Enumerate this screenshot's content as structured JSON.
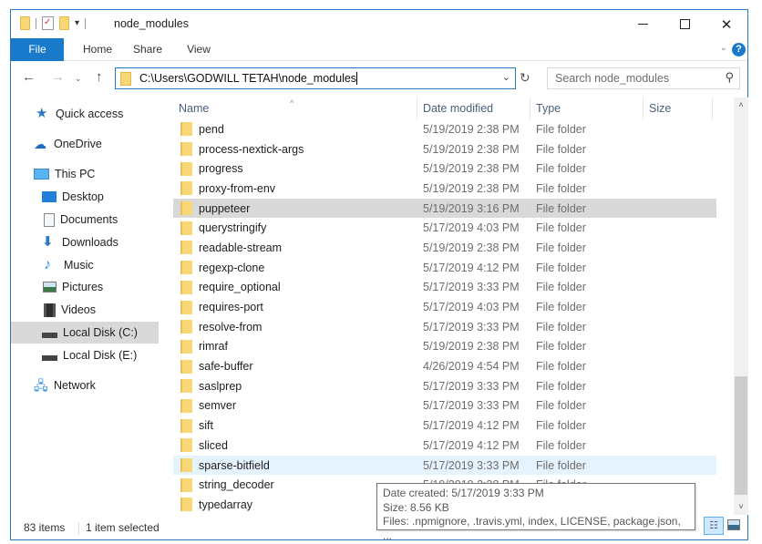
{
  "window": {
    "title": "node_modules",
    "controls": {
      "minimize": "–",
      "maximize": "□",
      "close": "✕"
    }
  },
  "quick_access_toolbar": {
    "icons": [
      "folder-icon",
      "properties-icon",
      "new-folder-icon"
    ],
    "dropdown": "▾"
  },
  "ribbon": {
    "tabs": [
      {
        "label": "File",
        "active": true
      },
      {
        "label": "Home"
      },
      {
        "label": "Share"
      },
      {
        "label": "View"
      }
    ],
    "expand_chevron": "⌄",
    "help": "?"
  },
  "navigation": {
    "back": "←",
    "forward": "→",
    "recent": "⌄",
    "up": "↑",
    "address": "C:\\Users\\GODWILL TETAH\\node_modules",
    "address_dropdown": "⌄",
    "refresh": "↻",
    "search_placeholder": "Search node_modules",
    "search_icon": "⚲"
  },
  "nav_pane": {
    "items": [
      {
        "label": "Quick access",
        "icon": "star-icon",
        "level": 0
      },
      {
        "label": "OneDrive",
        "icon": "cloud-icon",
        "level": 0
      },
      {
        "label": "This PC",
        "icon": "computer-icon",
        "level": 0
      },
      {
        "label": "Desktop",
        "icon": "desktop-icon",
        "level": 1
      },
      {
        "label": "Documents",
        "icon": "documents-icon",
        "level": 1
      },
      {
        "label": "Downloads",
        "icon": "download-icon",
        "level": 1
      },
      {
        "label": "Music",
        "icon": "music-icon",
        "level": 1
      },
      {
        "label": "Pictures",
        "icon": "pictures-icon",
        "level": 1
      },
      {
        "label": "Videos",
        "icon": "videos-icon",
        "level": 1
      },
      {
        "label": "Local Disk (C:)",
        "icon": "drive-icon",
        "level": 1,
        "selected": true
      },
      {
        "label": "Local Disk  (E:)",
        "icon": "drive-icon",
        "level": 1
      },
      {
        "label": "Network",
        "icon": "network-icon",
        "level": 0
      }
    ]
  },
  "file_list": {
    "columns": [
      "Name",
      "Date modified",
      "Type",
      "Size"
    ],
    "sort_indicator": "^",
    "rows": [
      {
        "name": "pend",
        "date": "5/19/2019 2:38 PM",
        "type": "File folder",
        "size": ""
      },
      {
        "name": "process-nextick-args",
        "date": "5/19/2019 2:38 PM",
        "type": "File folder",
        "size": ""
      },
      {
        "name": "progress",
        "date": "5/19/2019 2:38 PM",
        "type": "File folder",
        "size": ""
      },
      {
        "name": "proxy-from-env",
        "date": "5/19/2019 2:38 PM",
        "type": "File folder",
        "size": ""
      },
      {
        "name": "puppeteer",
        "date": "5/19/2019 3:16 PM",
        "type": "File folder",
        "size": "",
        "state": "selected"
      },
      {
        "name": "querystringify",
        "date": "5/17/2019 4:03 PM",
        "type": "File folder",
        "size": ""
      },
      {
        "name": "readable-stream",
        "date": "5/19/2019 2:38 PM",
        "type": "File folder",
        "size": ""
      },
      {
        "name": "regexp-clone",
        "date": "5/17/2019 4:12 PM",
        "type": "File folder",
        "size": ""
      },
      {
        "name": "require_optional",
        "date": "5/17/2019 3:33 PM",
        "type": "File folder",
        "size": ""
      },
      {
        "name": "requires-port",
        "date": "5/17/2019 4:03 PM",
        "type": "File folder",
        "size": ""
      },
      {
        "name": "resolve-from",
        "date": "5/17/2019 3:33 PM",
        "type": "File folder",
        "size": ""
      },
      {
        "name": "rimraf",
        "date": "5/19/2019 2:38 PM",
        "type": "File folder",
        "size": ""
      },
      {
        "name": "safe-buffer",
        "date": "4/26/2019 4:54 PM",
        "type": "File folder",
        "size": ""
      },
      {
        "name": "saslprep",
        "date": "5/17/2019 3:33 PM",
        "type": "File folder",
        "size": ""
      },
      {
        "name": "semver",
        "date": "5/17/2019 3:33 PM",
        "type": "File folder",
        "size": ""
      },
      {
        "name": "sift",
        "date": "5/17/2019 4:12 PM",
        "type": "File folder",
        "size": ""
      },
      {
        "name": "sliced",
        "date": "5/17/2019 4:12 PM",
        "type": "File folder",
        "size": ""
      },
      {
        "name": "sparse-bitfield",
        "date": "5/17/2019 3:33 PM",
        "type": "File folder",
        "size": "",
        "state": "hover"
      },
      {
        "name": "string_decoder",
        "date": "5/19/2019 2:38 PM",
        "type": "File folder",
        "size": ""
      },
      {
        "name": "typedarray",
        "date": "",
        "type": "",
        "size": ""
      }
    ]
  },
  "scrollbar": {
    "up": "˄",
    "down": "˅",
    "position_fraction": 0.72
  },
  "tooltip": {
    "date_created": "Date created: 5/17/2019 3:33 PM",
    "size": "Size: 8.56 KB",
    "files": "Files: .npmignore, .travis.yml, index, LICENSE, package.json, ..."
  },
  "status_bar": {
    "item_count": "83 items",
    "selection": "1 item selected",
    "view_details_icon": "☷"
  },
  "colors": {
    "accent": "#1979ca",
    "window_border": "#2b79c2",
    "selected_row": "#d9d9d9",
    "hover_row": "#e5f3ff",
    "folder": "#f8d775"
  }
}
